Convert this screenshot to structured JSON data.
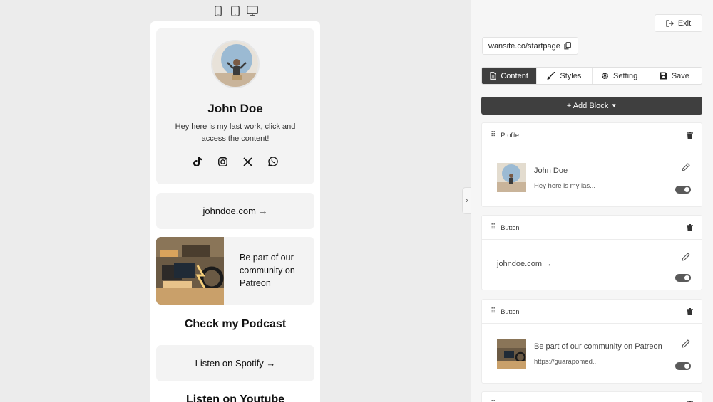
{
  "device_switcher": [
    "mobile-icon",
    "tablet-icon",
    "desktop-icon"
  ],
  "preview": {
    "profile": {
      "name": "John Doe",
      "bio": "Hey here is my last work, click and access the content!",
      "socials": [
        "tiktok-icon",
        "instagram-icon",
        "x-icon",
        "whatsapp-icon"
      ]
    },
    "link1": "johndoe.com →",
    "patreon_text": "Be part of our community on Patreon",
    "section1": "Check my Podcast",
    "link2": "Listen on Spotify →",
    "section2": "Listen on Youtube"
  },
  "editor": {
    "exit_label": "Exit",
    "url": "wansite.co/startpage",
    "tabs": [
      {
        "label": "Content",
        "icon": "document-icon",
        "active": true
      },
      {
        "label": "Styles",
        "icon": "brush-icon",
        "active": false
      },
      {
        "label": "Setting",
        "icon": "gear-icon",
        "active": false
      },
      {
        "label": "Save",
        "icon": "floppy-icon",
        "active": false
      }
    ],
    "add_block_label": "+ Add Block",
    "blocks": [
      {
        "type": "Profile",
        "title": "John Doe",
        "subtitle": "Hey here is my las...",
        "enabled": true
      },
      {
        "type": "Button",
        "title": "johndoe.com →",
        "subtitle": "",
        "enabled": true
      },
      {
        "type": "Button",
        "title": "Be part of our community on Patreon",
        "subtitle": "https://guarapomed...",
        "enabled": true
      }
    ]
  },
  "colors": {
    "accent_dark": "#3f3f3f",
    "card_bg": "#f3f3f3",
    "page_bg": "#ececec"
  }
}
